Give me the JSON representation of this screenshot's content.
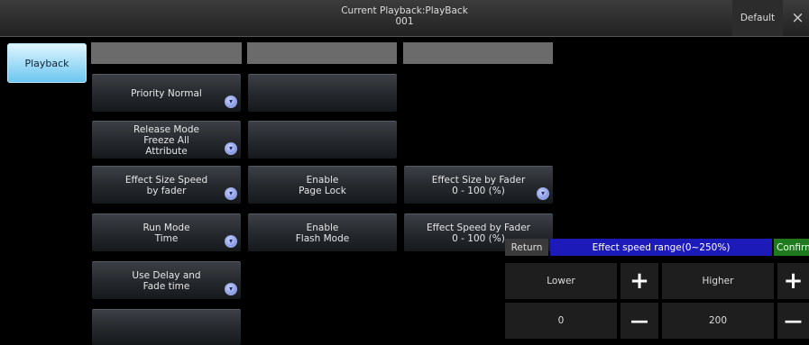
{
  "header": {
    "title_line1": "Current Playback:PlayBack",
    "title_line2": "001",
    "default_label": "Default",
    "close_glyph": "×"
  },
  "sidebar": {
    "tab_label": "Playback"
  },
  "grid": {
    "col1": [
      "Priority Normal",
      "Release Mode\nFreeze All\nAttribute",
      "Effect Size Speed\nby fader",
      "Run Mode\nTime",
      "Use Delay and\nFade time",
      ""
    ],
    "col2": [
      "",
      "",
      "Enable\nPage Lock",
      "Enable\nFlash Mode"
    ],
    "col3": [
      "Effect Size by Fader\n0 - 100 (%)",
      "Effect Speed by Fader\n0 - 100 (%)"
    ]
  },
  "popup": {
    "return_label": "Return",
    "title": "Effect speed range(0~250%)",
    "confirm_label": "Confirm",
    "lower_label": "Lower",
    "higher_label": "Higher",
    "lower_value": "0",
    "higher_value": "200",
    "plus_glyph": "+",
    "minus_glyph": "—"
  },
  "icons": {
    "dropdown": "chevron-down-icon"
  },
  "colors": {
    "tab_accent": "#6cc6f0",
    "popup_title_bg": "#1c1ab8",
    "confirm_bg": "#1f7a1f"
  }
}
